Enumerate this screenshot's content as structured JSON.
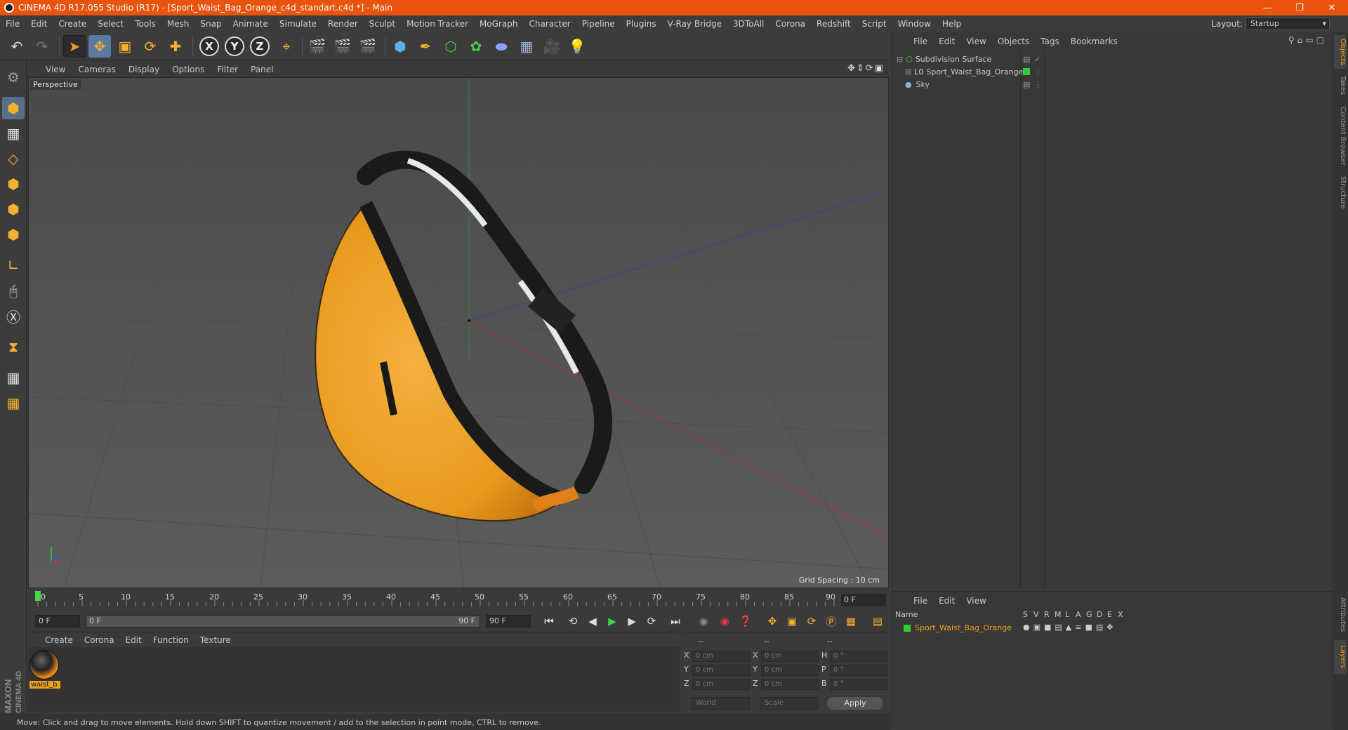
{
  "titlebar": {
    "title": "CINEMA 4D R17.055 Studio (R17) - [Sport_Waist_Bag_Orange_c4d_standart.c4d *] - Main"
  },
  "menubar": {
    "items": [
      "File",
      "Edit",
      "Create",
      "Select",
      "Tools",
      "Mesh",
      "Snap",
      "Animate",
      "Simulate",
      "Render",
      "Sculpt",
      "Motion Tracker",
      "MoGraph",
      "Character",
      "Pipeline",
      "Plugins",
      "V-Ray Bridge",
      "3DToAll",
      "Corona",
      "Redshift",
      "Script",
      "Window",
      "Help"
    ],
    "layout_label": "Layout:",
    "layout_value": "Startup"
  },
  "viewport": {
    "menu": [
      "View",
      "Cameras",
      "Display",
      "Options",
      "Filter",
      "Panel"
    ],
    "label": "Perspective",
    "grid_spacing": "Grid Spacing : 10 cm"
  },
  "timeline": {
    "ticks": [
      "0",
      "5",
      "10",
      "15",
      "20",
      "25",
      "30",
      "35",
      "40",
      "45",
      "50",
      "55",
      "60",
      "65",
      "70",
      "75",
      "80",
      "85",
      "90"
    ],
    "current_frame": "0 F",
    "start_field": "0 F",
    "range_start": "0 F",
    "range_end": "90 F",
    "end_field": "90 F"
  },
  "materials": {
    "menu": [
      "Create",
      "Corona",
      "Edit",
      "Function",
      "Texture"
    ],
    "items": [
      {
        "label": "waist_b"
      }
    ]
  },
  "coordinates": {
    "header": [
      "--",
      "--",
      "--"
    ],
    "rows": [
      {
        "axis": "X",
        "pos": "0 cm",
        "axis2": "X",
        "size": "0 cm",
        "rot_label": "H",
        "rot": "0 °"
      },
      {
        "axis": "Y",
        "pos": "0 cm",
        "axis2": "Y",
        "size": "0 cm",
        "rot_label": "P",
        "rot": "0 °"
      },
      {
        "axis": "Z",
        "pos": "0 cm",
        "axis2": "Z",
        "size": "0 cm",
        "rot_label": "B",
        "rot": "0 °"
      }
    ],
    "space": "World",
    "mode": "Scale",
    "apply": "Apply"
  },
  "status": {
    "text": "Move: Click and drag to move elements. Hold down SHIFT to quantize movement / add to the selection in point mode, CTRL to remove."
  },
  "object_manager": {
    "menu": [
      "File",
      "Edit",
      "View",
      "Objects",
      "Tags",
      "Bookmarks"
    ],
    "objects": [
      {
        "name": "Subdivision Surface",
        "color": "#c8c8c8"
      },
      {
        "name": "Sport_Waist_Bag_Orange",
        "color": "#c8c8c8"
      },
      {
        "name": "Sky",
        "color": "#c8c8c8"
      }
    ]
  },
  "layers": {
    "menu": [
      "File",
      "Edit",
      "View"
    ],
    "header_name": "Name",
    "header_cols": [
      "S",
      "V",
      "R",
      "M",
      "L",
      "A",
      "G",
      "D",
      "E",
      "X"
    ],
    "row_name": "Sport_Waist_Bag_Orange"
  },
  "right_tabs": [
    "Objects",
    "Takes",
    "Content Browser",
    "Structure",
    "Attributes",
    "Layers"
  ],
  "logo": "MAXON CINEMA 4D",
  "colors": {
    "accent_orange": "#e8530e",
    "layer_green": "#33cc33",
    "bag_orange": "#f0a020"
  }
}
